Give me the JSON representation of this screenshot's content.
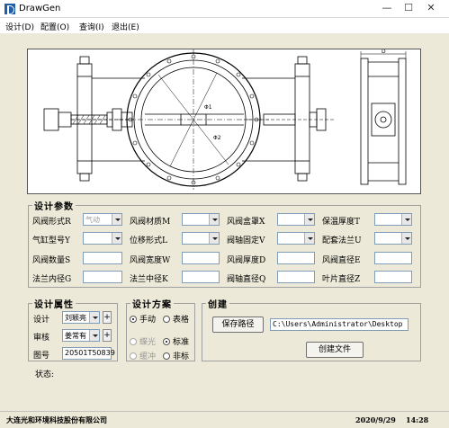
{
  "window": {
    "title": "DrawGen",
    "minimize": "—",
    "maximize": "☐",
    "close": "✕"
  },
  "menu": [
    "设计(D)",
    "配置(O)",
    "查询(I)",
    "退出(E)"
  ],
  "drawing": {
    "dim_labels": [
      "D",
      "Φ1",
      "Φ2"
    ]
  },
  "design_params": {
    "title": "设计参数",
    "fields": [
      {
        "label": "风阀形式R",
        "type": "combo",
        "value": "气动",
        "disabled": true
      },
      {
        "label": "风阀材质M",
        "type": "combo",
        "value": ""
      },
      {
        "label": "风阀盒罩X",
        "type": "combo",
        "value": ""
      },
      {
        "label": "保温厚度T",
        "type": "combo",
        "value": ""
      },
      {
        "label": "气缸型号Y",
        "type": "combo",
        "value": ""
      },
      {
        "label": "位移形式L",
        "type": "combo",
        "value": ""
      },
      {
        "label": "阀轴固定V",
        "type": "combo",
        "value": ""
      },
      {
        "label": "配套法兰U",
        "type": "combo",
        "value": ""
      },
      {
        "label": "风阀数量S",
        "type": "text",
        "value": ""
      },
      {
        "label": "风阀宽度W",
        "type": "text",
        "value": ""
      },
      {
        "label": "风阀厚度D",
        "type": "text",
        "value": ""
      },
      {
        "label": "风阀直径E",
        "type": "text",
        "value": ""
      },
      {
        "label": "法兰内径G",
        "type": "text",
        "value": ""
      },
      {
        "label": "法兰中径K",
        "type": "text",
        "value": ""
      },
      {
        "label": "阀轴直径Q",
        "type": "text",
        "value": ""
      },
      {
        "label": "叶片直径Z",
        "type": "text",
        "value": ""
      }
    ]
  },
  "design_attrs": {
    "title": "设计属性",
    "designer_label": "设计",
    "designer_value": "刘颖亮",
    "reviewer_label": "审核",
    "reviewer_value": "姜常有",
    "drawing_no_label": "图号",
    "drawing_no_value": "20501T50839",
    "plus": "+"
  },
  "design_plan": {
    "title": "设计方案",
    "options": [
      {
        "label": "手动",
        "checked": true,
        "disabled": false
      },
      {
        "label": "表格",
        "checked": false,
        "disabled": false
      },
      {
        "label": "蝶光",
        "checked": false,
        "disabled": true
      },
      {
        "label": "标准",
        "checked": true,
        "disabled": false
      },
      {
        "label": "缓冲",
        "checked": false,
        "disabled": true
      },
      {
        "label": "非标",
        "checked": false,
        "disabled": false
      }
    ]
  },
  "create": {
    "title": "创建",
    "save_path_label": "保存路径",
    "path_value": "C:\\Users\\Administrator\\Desktop",
    "create_file_label": "创建文件"
  },
  "status": {
    "label": "状态:"
  },
  "statusbar": {
    "company": "大连光和环境科技股份有限公司",
    "date": "2020/9/29",
    "time": "14:28"
  }
}
